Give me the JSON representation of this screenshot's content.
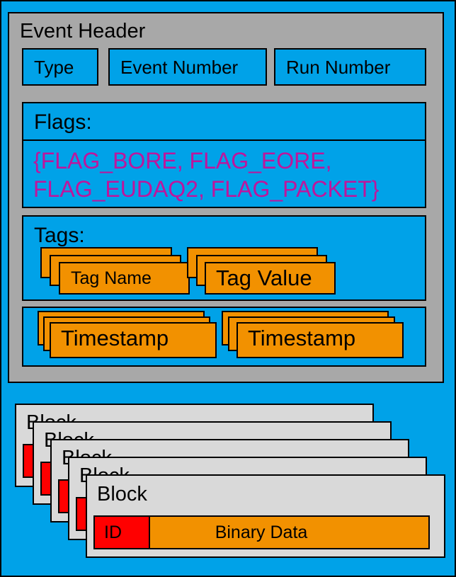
{
  "header": {
    "title": "Event Header",
    "type_label": "Type",
    "event_number_label": "Event Number",
    "run_number_label": "Run Number",
    "flags_label": "Flags:",
    "flags_line1": "{FLAG_BORE, FLAG_EORE,",
    "flags_line2": "FLAG_EUDAQ2, FLAG_PACKET}",
    "tags_label": "Tags:",
    "tag_name_label": "Tag Name",
    "tag_value_label": "Tag Value",
    "timestamp_begin_label": "Timestamp",
    "timestamp_end_label": "Timestamp"
  },
  "blocks": {
    "block_label": "Block",
    "id_label": "ID",
    "binary_data_label": "Binary Data"
  },
  "colors": {
    "container_blue": "#00A2E8",
    "header_gray": "#A8A8A8",
    "item_orange": "#F29100",
    "flag_text_magenta": "#C0149C",
    "block_gray": "#D9D9D9",
    "id_red": "#FF0000"
  }
}
